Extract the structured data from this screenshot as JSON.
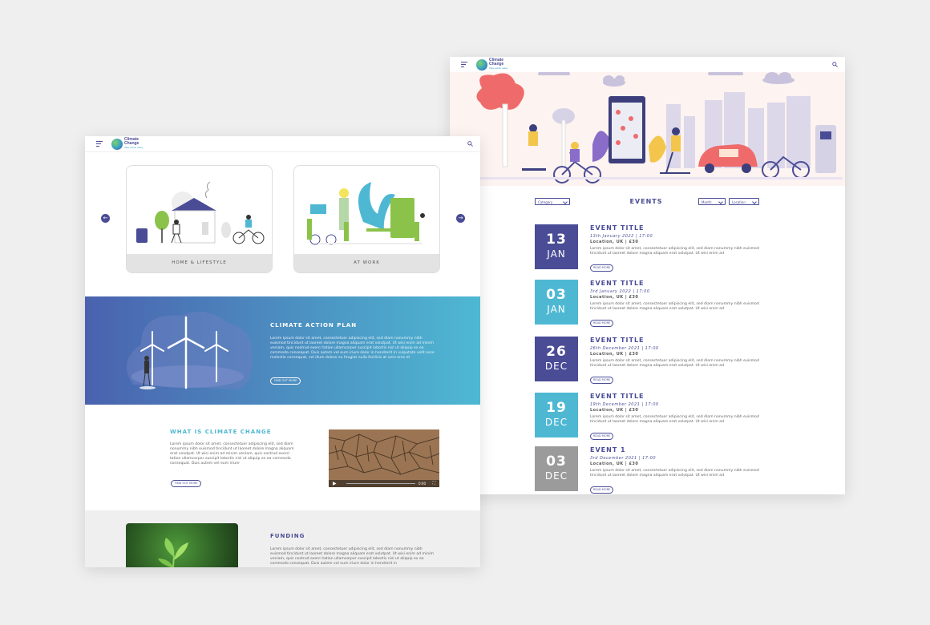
{
  "brand": {
    "name_line1": "Climate",
    "name_line2": "Change",
    "tagline": "Take action today"
  },
  "colors": {
    "primary": "#4a4c96",
    "accent": "#4eb8d3",
    "grey": "#9b9b9b"
  },
  "events_page": {
    "heading": "EVENTS",
    "filters": {
      "category": "Category",
      "month": "Month",
      "location": "Location"
    },
    "events": [
      {
        "day": "13",
        "month": "JAN",
        "title": "EVENT TITLE",
        "date": "13th January 2022 | 17:00",
        "location": "Location, UK | £30",
        "text": "Lorem ipsum dolor sit amet, consectetuer adipiscing elit, sed diam nonummy nibh euismod tincidunt ut laoreet dolore magna aliquam erat volutpat. Ut wisi enim ad",
        "button": "READ MORE",
        "color": "#4a4c96"
      },
      {
        "day": "03",
        "month": "JAN",
        "title": "EVENT TITLE",
        "date": "3rd January 2022 | 17:00",
        "location": "Location, UK | £30",
        "text": "Lorem ipsum dolor sit amet, consectetuer adipiscing elit, sed diam nonummy nibh euismod tincidunt ut laoreet dolore magna aliquam erat volutpat. Ut wisi enim ad",
        "button": "READ MORE",
        "color": "#4eb8d3"
      },
      {
        "day": "26",
        "month": "DEC",
        "title": "EVENT TITLE",
        "date": "26th December 2021 | 17:00",
        "location": "Location, UK | £30",
        "text": "Lorem ipsum dolor sit amet, consectetuer adipiscing elit, sed diam nonummy nibh euismod tincidunt ut laoreet dolore magna aliquam erat volutpat. Ut wisi enim ad",
        "button": "READ MORE",
        "color": "#4a4c96"
      },
      {
        "day": "19",
        "month": "DEC",
        "title": "EVENT TITLE",
        "date": "19th December 2021 | 17:00",
        "location": "Location, UK | £30",
        "text": "Lorem ipsum dolor sit amet, consectetuer adipiscing elit, sed diam nonummy nibh euismod tincidunt ut laoreet dolore magna aliquam erat volutpat. Ut wisi enim ad",
        "button": "READ MORE",
        "color": "#4eb8d3"
      },
      {
        "day": "03",
        "month": "DEC",
        "title": "EVENT 1",
        "date": "3rd December 2021 | 17:00",
        "location": "Location, UK | £30",
        "text": "Lorem ipsum dolor sit amet, consectetuer adipiscing elit, sed diam nonummy nibh euismod tincidunt ut laoreet dolore magna aliquam erat volutpat. Ut wisi enim ad",
        "button": "READ MORE",
        "color": "#9b9b9b"
      }
    ]
  },
  "home_page": {
    "cards": [
      {
        "label": "HOME & LIFESTYLE"
      },
      {
        "label": "AT WORK"
      }
    ],
    "carousel": {
      "prev": "←",
      "next": "→"
    },
    "action_plan": {
      "title": "CLIMATE ACTION PLAN",
      "text": "Lorem ipsum dolor sit amet, consectetuer adipiscing elit, sed diam nonummy nibh euismod tincidunt ut laoreet dolore magna aliquam erat volutpat. Ut wisi enim ad minim veniam, quis nostrud exerci tation ullamcorper suscipit lobortis nisl ut aliquip ex ea commodo consequat. Duis autem vel eum iriure dolor in hendrerit in vulputate velit esse molestie consequat, vel illum dolore eu feugiat nulla facilisis at vero eros et",
      "button": "FIND OUT MORE"
    },
    "what_is": {
      "title": "WHAT IS CLIMATE CHANGE",
      "text": "Lorem ipsum dolor sit amet, consectetuer adipiscing elit, sed diam nonummy nibh euismod tincidunt ut laoreet dolore magna aliquam erat volutpat. Ut wisi enim ad minim veniam, quis nostrud exerci tation ullamcorper suscipit lobortis nisl ut aliquip ex ea commodo consequat. Duis autem vel eum iriure",
      "button": "FIND OUT MORE",
      "video_time": "0:00"
    },
    "funding": {
      "title": "FUNDING",
      "text": "Lorem ipsum dolor sit amet, consectetuer adipiscing elit, sed diam nonummy nibh euismod tincidunt ut laoreet dolore magna aliquam erat volutpat. Ut wisi enim ad minim veniam, quis nostrud exerci tation ullamcorper suscipit lobortis nisl ut aliquip ex ea commodo consequat. Duis autem vel eum iriure dolor in hendrerit in"
    }
  }
}
